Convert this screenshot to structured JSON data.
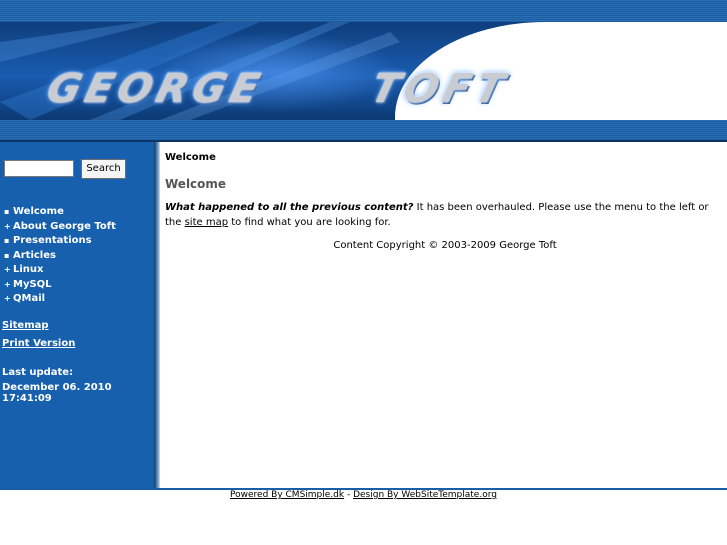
{
  "header": {
    "logo_first": "GEORGE",
    "logo_second": "TOFT"
  },
  "sidebar": {
    "search_placeholder": "",
    "search_button": "Search",
    "menu": [
      {
        "label": "Welcome",
        "bullet": "▪"
      },
      {
        "label": "About George Toft",
        "bullet": "+"
      },
      {
        "label": "Presentations",
        "bullet": "▪"
      },
      {
        "label": "Articles",
        "bullet": "▪"
      },
      {
        "label": "Linux",
        "bullet": "+"
      },
      {
        "label": "MySQL",
        "bullet": "+"
      },
      {
        "label": "QMail",
        "bullet": "+"
      }
    ],
    "sitemap": "Sitemap",
    "print_version": "Print Version",
    "last_update_label": "Last update:",
    "last_update_value": "December 06. 2010 17:41:09"
  },
  "main": {
    "breadcrumb": "Welcome",
    "heading": "Welcome",
    "lead": "What happened to all the previous content?",
    "text_before": " It has been overhauled. Please use the menu to the left or the ",
    "site_map_link": "site map",
    "text_after": " to find what you are looking for.",
    "copyright": "Content Copyright © 2003-2009 George Toft"
  },
  "footer": {
    "powered": "Powered By CMSimple.dk",
    "separator": " - ",
    "design": "Design By WebSiteTemplate.org"
  },
  "colors": {
    "sidebar": "#1660ae",
    "banner": "#1a5cb0",
    "heading": "#555555"
  }
}
